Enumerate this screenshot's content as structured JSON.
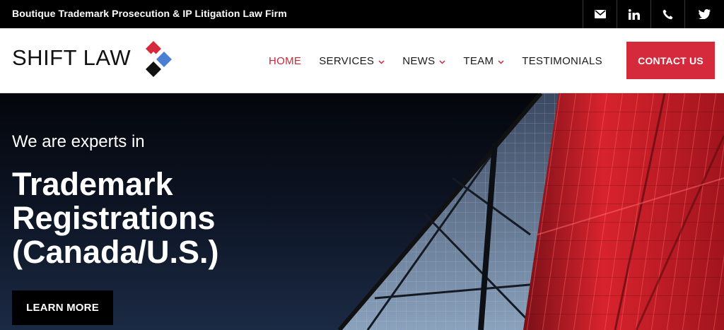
{
  "topbar": {
    "tagline": "Boutique Trademark Prosecution & IP Litigation Law Firm",
    "social": [
      "mail-icon",
      "linkedin-icon",
      "phone-icon",
      "twitter-icon"
    ]
  },
  "header": {
    "logo_text": "SHIFT LAW",
    "nav": [
      {
        "label": "HOME",
        "active": true,
        "dropdown": false
      },
      {
        "label": "SERVICES",
        "active": false,
        "dropdown": true
      },
      {
        "label": "NEWS",
        "active": false,
        "dropdown": true
      },
      {
        "label": "TEAM",
        "active": false,
        "dropdown": true
      },
      {
        "label": "TESTIMONIALS",
        "active": false,
        "dropdown": false
      }
    ],
    "cta_label": "CONTACT US"
  },
  "hero": {
    "subtitle": "We are experts in",
    "title_lines": [
      "Trademark",
      "Registrations",
      "(Canada/U.S.)"
    ],
    "button_label": "LEARN MORE"
  },
  "colors": {
    "accent_red": "#d42a3c",
    "nav_active": "#c7283a",
    "logo_blue": "#4a7fd4",
    "topbar_bg": "#000000"
  }
}
